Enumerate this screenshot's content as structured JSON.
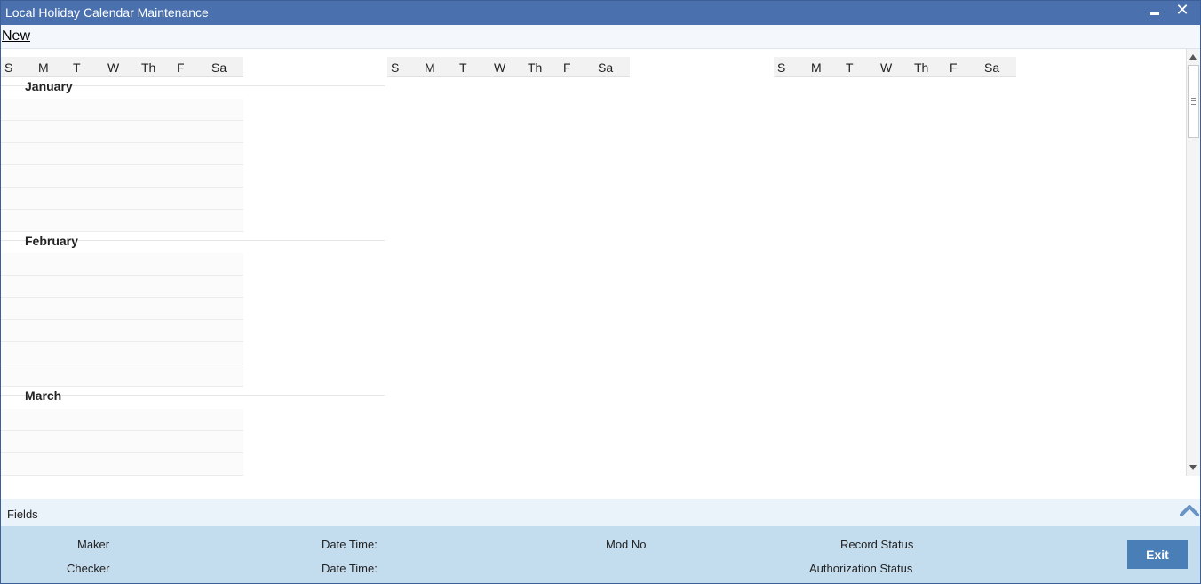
{
  "window": {
    "title": "Local Holiday Calendar Maintenance"
  },
  "toolbar": {
    "new_label": "New"
  },
  "days": [
    "S",
    "M",
    "T",
    "W",
    "Th",
    "F",
    "Sa"
  ],
  "months": {
    "january": "January",
    "february": "February",
    "march": "March"
  },
  "fields": {
    "label": "Fields"
  },
  "footer": {
    "maker": "Maker",
    "checker": "Checker",
    "date_time_1": "Date Time:",
    "date_time_2": "Date Time:",
    "mod_no": "Mod No",
    "record_status": "Record Status",
    "authorization_status": "Authorization Status",
    "exit_label": "Exit"
  },
  "colors": {
    "titlebar": "#4a70ad",
    "footer": "#c3dcee",
    "exit_button": "#4a7eb6"
  }
}
